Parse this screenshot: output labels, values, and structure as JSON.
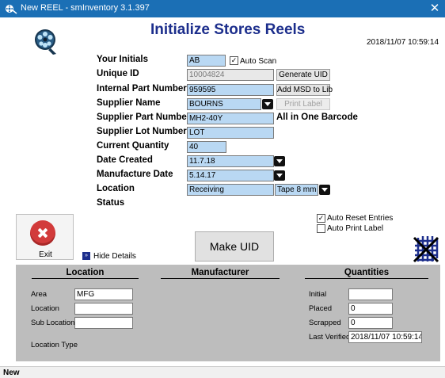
{
  "window": {
    "title": "New REEL - smInventory 3.1.397",
    "close_glyph": "✕",
    "app_icon": "reel-app-icon"
  },
  "header": {
    "title": "Initialize Stores Reels",
    "datetime": "2018/11/07 10:59:14",
    "logo": "film-reel-icon"
  },
  "form": {
    "initials": {
      "label": "Your Initials",
      "value": "AB"
    },
    "auto_scan": {
      "label": "Auto Scan",
      "checked": true
    },
    "unique_id": {
      "label": "Unique ID",
      "value": "10004824"
    },
    "generate_uid": "Generate UID",
    "internal_part": {
      "label": "Internal Part Number",
      "value": "959595"
    },
    "add_msd": "Add MSD to Lib",
    "supplier_name": {
      "label": "Supplier Name",
      "value": "BOURNS"
    },
    "print_label": "Print Label",
    "supplier_part": {
      "label": "Supplier Part Number",
      "value": "MH2-40Y"
    },
    "barcode_note": "All in One Barcode",
    "supplier_lot": {
      "label": "Supplier Lot Number",
      "value": "LOT"
    },
    "quantity": {
      "label": "Current Quantity",
      "value": "40"
    },
    "date_created": {
      "label": "Date Created",
      "value": "11.7.18"
    },
    "manufacture_date": {
      "label": "Manufacture Date",
      "value": "5.14.17"
    },
    "location": {
      "label": "Location",
      "value": "Receiving",
      "tape": "Tape 8 mm"
    },
    "status": {
      "label": "Status"
    }
  },
  "options": {
    "auto_reset": {
      "label": "Auto Reset Entries",
      "checked": true
    },
    "auto_print": {
      "label": "Auto Print Label",
      "checked": false
    }
  },
  "actions": {
    "exit": "Exit",
    "hide_details": "Hide Details",
    "hide_icon_glyph": "»",
    "make_uid": "Make UID"
  },
  "details": {
    "location_title": "Location",
    "manufacturer_title": "Manufacturer",
    "quantities_title": "Quantities",
    "area": {
      "label": "Area",
      "value": "MFG"
    },
    "location": {
      "label": "Location",
      "value": ""
    },
    "sub_location": {
      "label": "Sub Location",
      "value": ""
    },
    "location_type": {
      "label": "Location Type"
    },
    "initial": {
      "label": "Initial",
      "value": ""
    },
    "placed": {
      "label": "Placed",
      "value": "0"
    },
    "scrapped": {
      "label": "Scrapped",
      "value": "0"
    },
    "last_verified": {
      "label": "Last Verified",
      "value": "2018/11/07 10:59:14"
    }
  },
  "statusbar": {
    "text": "New"
  },
  "colors": {
    "titlebar": "#1b6fb5",
    "heading": "#1c2e8c",
    "field_fill": "#b9d8f3",
    "panel": "#bdbdbd",
    "exit_red": "#d23b3b"
  }
}
